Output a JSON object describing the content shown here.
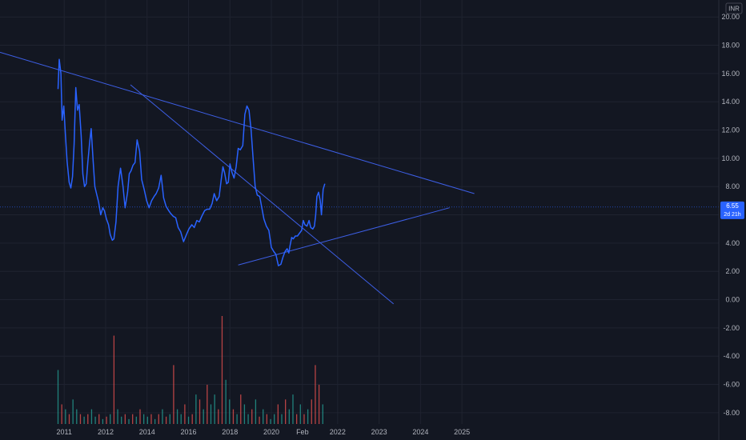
{
  "chart_data": {
    "type": "line",
    "currency": "INR",
    "price_badge": {
      "price": "6.55",
      "countdown": "2d 21h"
    },
    "colors": {
      "background": "#131722",
      "grid": "#1f2330",
      "price_line": "#2962ff",
      "trendline": "#3d5fe6",
      "volume_up": "#26a69a",
      "volume_down": "#ef5350",
      "badge": "#2962ff"
    },
    "y_axis": {
      "ylim": [
        -8.8,
        21.2
      ],
      "ticks": [
        "20.00",
        "18.00",
        "16.00",
        "14.00",
        "12.00",
        "10.00",
        "8.00",
        "6.00",
        "4.00",
        "2.00",
        "0.00",
        "-2.00",
        "-4.00",
        "-6.00",
        "-8.00"
      ],
      "tick_values": [
        20,
        18,
        16,
        14,
        12,
        10,
        8,
        6,
        4,
        2,
        0,
        -2,
        -4,
        -6,
        -8
      ]
    },
    "x_axis": {
      "xlim": [
        2009.45,
        2026.8
      ],
      "ticks": [
        "2011",
        "2012",
        "2014",
        "2016",
        "2018",
        "2020",
        "Feb",
        "2022",
        "2023",
        "2024",
        "2025"
      ],
      "tick_values": [
        2011.0,
        2012.0,
        2013.0,
        2014.0,
        2015.0,
        2016.0,
        2016.75,
        2017.6,
        2018.6,
        2019.6,
        2020.6
      ]
    },
    "grid": true,
    "series": [
      {
        "x": [
          2010.85,
          2010.88,
          2010.92,
          2010.95,
          2010.99,
          2011.03,
          2011.07,
          2011.12,
          2011.16,
          2011.2,
          2011.24,
          2011.28,
          2011.32,
          2011.36,
          2011.41,
          2011.45,
          2011.49,
          2011.53,
          2011.57,
          2011.61,
          2011.65,
          2011.7,
          2011.74,
          2011.78,
          2011.83,
          2011.88,
          2011.93,
          2011.97,
          2012.02,
          2012.07,
          2012.11,
          2012.16,
          2012.2,
          2012.25,
          2012.3,
          2012.36,
          2012.42,
          2012.47,
          2012.53,
          2012.57,
          2012.61,
          2012.66,
          2012.71,
          2012.76,
          2012.82,
          2012.87,
          2012.93,
          2012.99,
          2013.05,
          2013.11,
          2013.17,
          2013.22,
          2013.28,
          2013.34,
          2013.4,
          2013.46,
          2013.52,
          2013.57,
          2013.63,
          2013.69,
          2013.75,
          2013.81,
          2013.88,
          2013.95,
          2014.01,
          2014.08,
          2014.14,
          2014.2,
          2014.26,
          2014.32,
          2014.39,
          2014.45,
          2014.51,
          2014.57,
          2014.62,
          2014.68,
          2014.74,
          2014.79,
          2014.83,
          2014.87,
          2014.92,
          2014.96,
          2015.0,
          2015.05,
          2015.1,
          2015.15,
          2015.2,
          2015.25,
          2015.31,
          2015.36,
          2015.41,
          2015.46,
          2015.51,
          2015.56,
          2015.61,
          2015.66,
          2015.72,
          2015.77,
          2015.82,
          2015.88,
          2015.94,
          2016.0,
          2016.06,
          2016.11,
          2016.17,
          2016.23,
          2016.28,
          2016.33,
          2016.38,
          2016.42,
          2016.45,
          2016.49,
          2016.53,
          2016.58,
          2016.63,
          2016.68,
          2016.73,
          2016.77,
          2016.81,
          2016.86,
          2016.91,
          2016.95,
          2017.0,
          2017.04,
          2017.07,
          2017.1,
          2017.14,
          2017.18,
          2017.21,
          2017.25,
          2017.29
        ],
        "y": [
          14.9,
          17.0,
          16.0,
          12.7,
          13.7,
          11.6,
          9.8,
          8.3,
          7.9,
          8.7,
          11.0,
          15.0,
          13.4,
          13.8,
          11.6,
          8.9,
          8.0,
          8.2,
          9.7,
          11.0,
          12.1,
          9.7,
          8.0,
          7.5,
          6.9,
          6.0,
          6.5,
          6.3,
          5.7,
          5.3,
          4.6,
          4.2,
          4.3,
          5.5,
          8.0,
          9.3,
          8.0,
          6.5,
          7.6,
          8.9,
          9.1,
          9.5,
          9.7,
          11.3,
          10.5,
          8.5,
          7.8,
          7.0,
          6.5,
          7.0,
          7.3,
          7.5,
          7.9,
          8.8,
          7.2,
          6.6,
          6.3,
          6.1,
          5.9,
          5.8,
          5.1,
          4.8,
          4.1,
          4.6,
          5.0,
          5.3,
          5.1,
          5.6,
          5.5,
          5.9,
          6.3,
          6.4,
          6.4,
          6.8,
          7.5,
          7.0,
          7.3,
          8.5,
          9.4,
          9.0,
          8.2,
          8.3,
          9.6,
          9.0,
          8.6,
          9.4,
          10.7,
          10.6,
          10.9,
          13.1,
          13.7,
          13.4,
          12.0,
          10.0,
          8.0,
          7.4,
          7.3,
          6.5,
          5.7,
          5.2,
          4.9,
          3.7,
          3.4,
          3.2,
          2.4,
          2.5,
          3.0,
          3.4,
          3.6,
          3.3,
          3.8,
          4.4,
          4.3,
          4.5,
          4.5,
          4.7,
          4.9,
          5.6,
          5.3,
          5.2,
          5.6,
          5.1,
          5.0,
          5.2,
          6.0,
          7.3,
          7.6,
          7.0,
          6.0,
          7.8,
          8.2
        ]
      }
    ],
    "trendlines": [
      {
        "from": [
          2009.45,
          17.5
        ],
        "to": [
          2020.9,
          7.5
        ]
      },
      {
        "from": [
          2012.6,
          15.2
        ],
        "to": [
          2018.95,
          -0.3
        ]
      },
      {
        "from": [
          2015.2,
          2.45
        ],
        "to": [
          2020.3,
          6.5
        ]
      }
    ],
    "volume": {
      "x": [
        2010.85,
        2010.94,
        2011.03,
        2011.12,
        2011.21,
        2011.3,
        2011.39,
        2011.48,
        2011.57,
        2011.66,
        2011.75,
        2011.84,
        2011.93,
        2012.02,
        2012.11,
        2012.2,
        2012.29,
        2012.38,
        2012.47,
        2012.56,
        2012.65,
        2012.74,
        2012.83,
        2012.92,
        2013.01,
        2013.1,
        2013.19,
        2013.28,
        2013.37,
        2013.46,
        2013.55,
        2013.64,
        2013.73,
        2013.82,
        2013.91,
        2014.0,
        2014.09,
        2014.18,
        2014.27,
        2014.36,
        2014.45,
        2014.54,
        2014.63,
        2014.72,
        2014.81,
        2014.9,
        2014.99,
        2015.08,
        2015.17,
        2015.26,
        2015.35,
        2015.44,
        2015.53,
        2015.62,
        2015.71,
        2015.8,
        2015.89,
        2015.98,
        2016.07,
        2016.16,
        2016.25,
        2016.34,
        2016.43,
        2016.52,
        2016.61,
        2016.7,
        2016.79,
        2016.88,
        2016.97,
        2017.06,
        2017.15,
        2017.24
      ],
      "values": [
        11,
        4,
        3,
        2,
        5,
        3,
        2,
        1.5,
        2,
        3,
        1.5,
        2,
        1,
        1.5,
        2,
        18,
        3,
        1.5,
        2,
        1,
        2,
        1.5,
        3,
        2,
        1.5,
        2,
        1,
        2,
        3,
        1.5,
        2,
        12,
        3,
        2,
        4,
        1.5,
        2,
        6,
        5,
        3,
        8,
        4,
        6,
        3,
        22,
        9,
        5,
        3,
        2,
        6,
        4,
        2,
        3,
        5,
        1.5,
        3,
        2,
        1,
        2,
        4,
        2,
        5,
        3,
        6,
        2,
        4,
        2,
        3,
        5,
        12,
        8,
        4
      ],
      "up": [
        true,
        false,
        true,
        false,
        true,
        true,
        false,
        true,
        false,
        true,
        true,
        false,
        true,
        false,
        true,
        false,
        true,
        true,
        false,
        true,
        false,
        true,
        false,
        true,
        true,
        false,
        true,
        false,
        true,
        false,
        true,
        false,
        true,
        true,
        false,
        true,
        false,
        true,
        false,
        true,
        false,
        true,
        true,
        false,
        false,
        true,
        true,
        false,
        true,
        false,
        true,
        true,
        false,
        true,
        false,
        true,
        false,
        true,
        true,
        false,
        true,
        false,
        true,
        true,
        false,
        true,
        false,
        true,
        false,
        false,
        false,
        true
      ]
    }
  }
}
